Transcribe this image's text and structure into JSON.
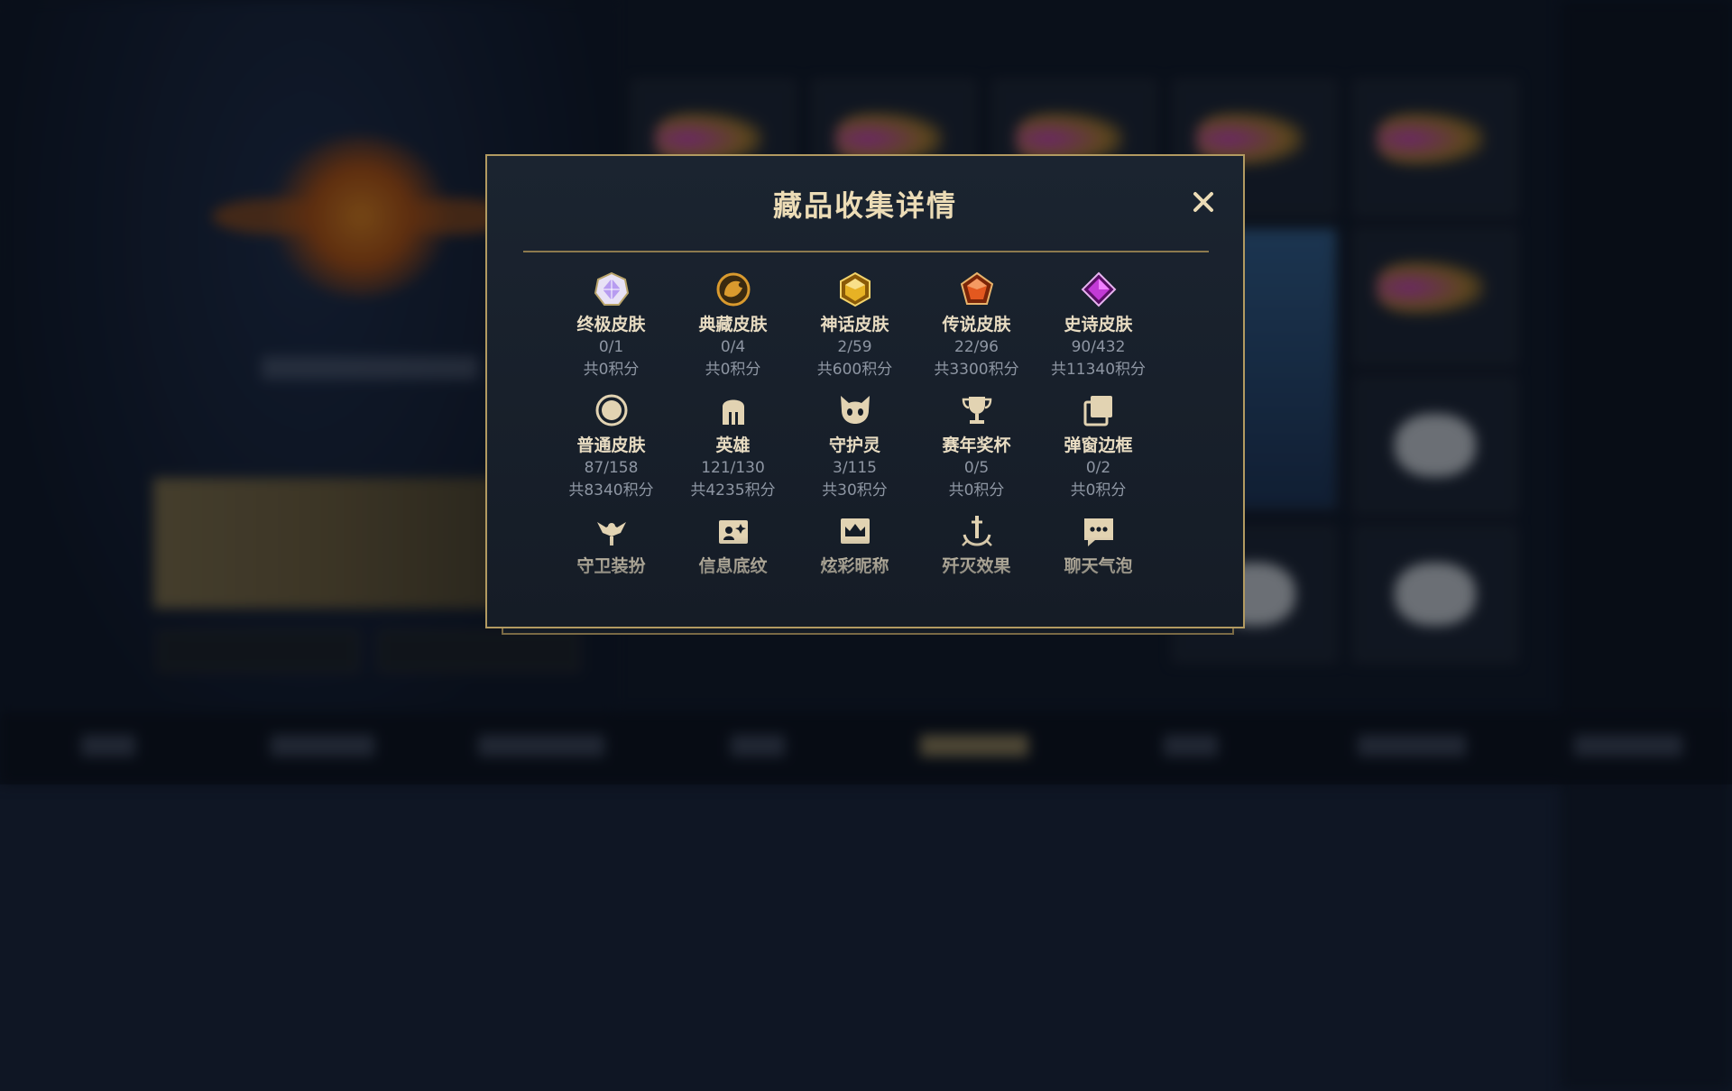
{
  "modal": {
    "title": "藏品收集详情",
    "close_icon": "close-icon"
  },
  "categories": [
    {
      "name": "终极皮肤",
      "count": "0/1",
      "score": "共0积分",
      "icon": "ultimate-skin-icon",
      "color": "#b79cf0"
    },
    {
      "name": "典藏皮肤",
      "count": "0/4",
      "score": "共0积分",
      "icon": "prestige-skin-icon",
      "color": "#d99a2e"
    },
    {
      "name": "神话皮肤",
      "count": "2/59",
      "score": "共600积分",
      "icon": "mythic-skin-icon",
      "color": "#e7b224"
    },
    {
      "name": "传说皮肤",
      "count": "22/96",
      "score": "共3300积分",
      "icon": "legendary-skin-icon",
      "color": "#e3581f"
    },
    {
      "name": "史诗皮肤",
      "count": "90/432",
      "score": "共11340积分",
      "icon": "epic-skin-icon",
      "color": "#c23ad6"
    },
    {
      "name": "普通皮肤",
      "count": "87/158",
      "score": "共8340积分",
      "icon": "normal-skin-icon",
      "color": "#e2d3b2"
    },
    {
      "name": "英雄",
      "count": "121/130",
      "score": "共4235积分",
      "icon": "champion-helmet-icon",
      "color": "#e2d3b2"
    },
    {
      "name": "守护灵",
      "count": "3/115",
      "score": "共30积分",
      "icon": "guardian-spirit-icon",
      "color": "#e2d3b2"
    },
    {
      "name": "赛年奖杯",
      "count": "0/5",
      "score": "共0积分",
      "icon": "trophy-icon",
      "color": "#e2d3b2"
    },
    {
      "name": "弹窗边框",
      "count": "0/2",
      "score": "共0积分",
      "icon": "popup-frame-icon",
      "color": "#e2d3b2"
    },
    {
      "name": "守卫装扮",
      "count": "",
      "score": "",
      "icon": "ward-skin-icon",
      "color": "#e2d3b2"
    },
    {
      "name": "信息底纹",
      "count": "",
      "score": "",
      "icon": "profile-banner-icon",
      "color": "#e2d3b2"
    },
    {
      "name": "炫彩昵称",
      "count": "",
      "score": "",
      "icon": "colorful-nickname-icon",
      "color": "#e2d3b2"
    },
    {
      "name": "歼灭效果",
      "count": "",
      "score": "",
      "icon": "elimination-effect-icon",
      "color": "#e2d3b2"
    },
    {
      "name": "聊天气泡",
      "count": "",
      "score": "",
      "icon": "chat-bubble-icon",
      "color": "#e2d3b2"
    }
  ],
  "colors": {
    "frame_gold": "#b29a61",
    "title_text": "#ecdcb6",
    "label_text": "#e8dcc2",
    "muted_text": "#8e96a3"
  }
}
